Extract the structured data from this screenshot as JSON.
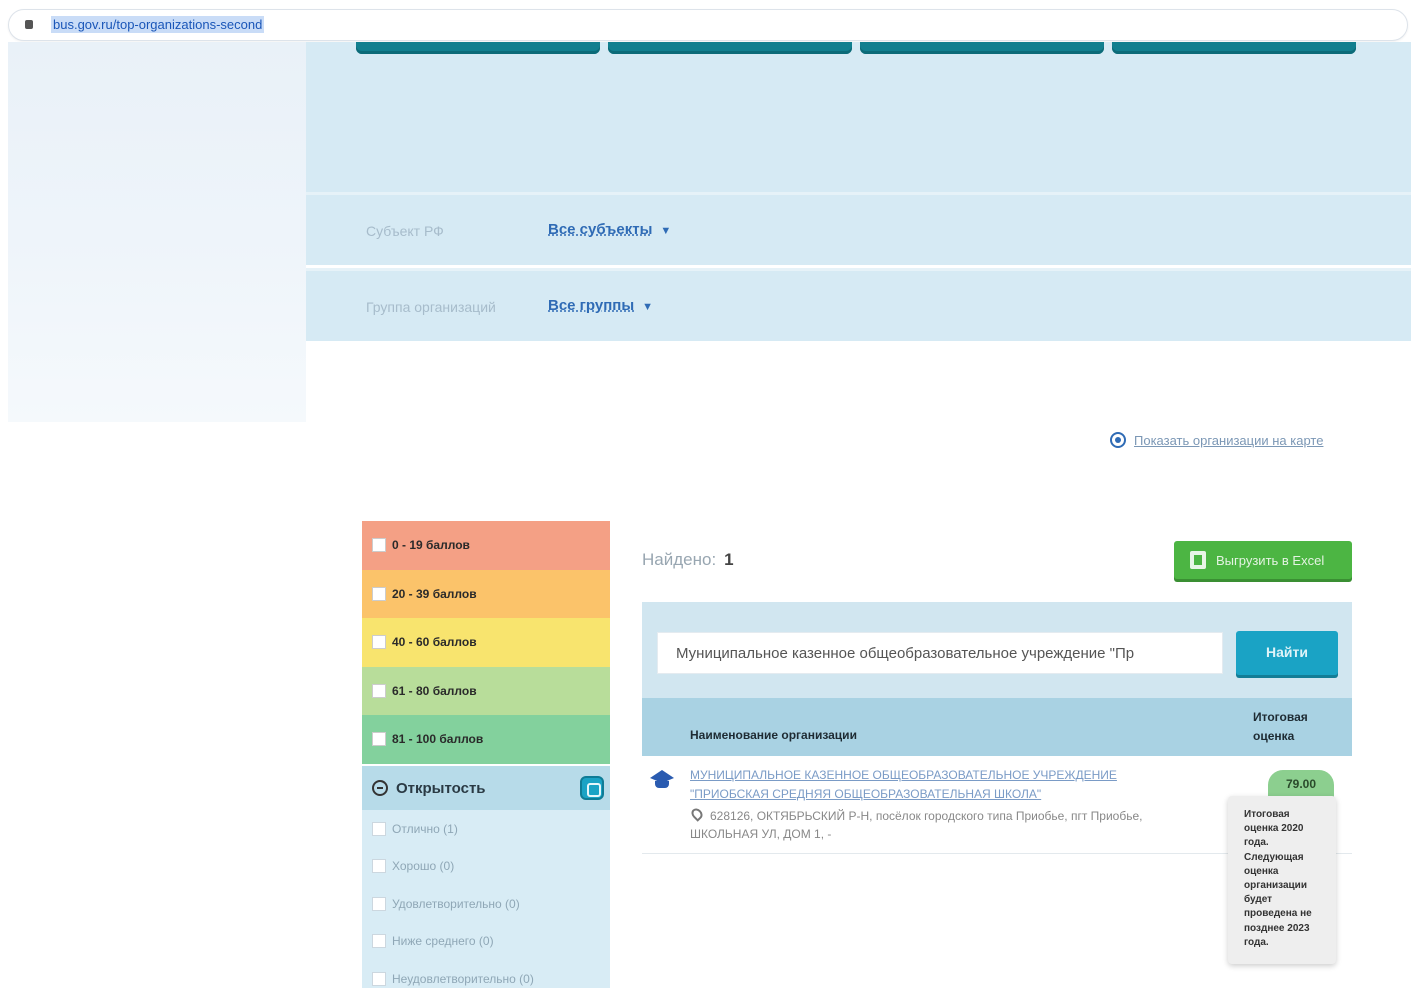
{
  "browser": {
    "url": "bus.gov.ru/top-organizations-second"
  },
  "filters": {
    "subject": {
      "label": "Субъект РФ",
      "value": "Все субъекты"
    },
    "group": {
      "label": "Группа организаций",
      "value": "Все группы"
    },
    "dropdown_arrow": "▼"
  },
  "map_link": {
    "label": "Показать организации на карте",
    "icon": "map-pin-icon"
  },
  "score_filters": [
    {
      "label": "0 - 19 баллов",
      "color": "#f4a085"
    },
    {
      "label": "20 - 39 баллов",
      "color": "#fbc36a"
    },
    {
      "label": "40 - 60 баллов",
      "color": "#f8e46e"
    },
    {
      "label": "61 - 80 баллов",
      "color": "#b8dd9a"
    },
    {
      "label": "81 - 100 баллов",
      "color": "#83d19d"
    }
  ],
  "openness": {
    "title": "Открытость",
    "items": [
      {
        "label": "Отлично (1)"
      },
      {
        "label": "Хорошо (0)"
      },
      {
        "label": "Удовлетворительно (0)"
      },
      {
        "label": "Ниже среднего (0)"
      },
      {
        "label": "Неудовлетворительно (0)"
      }
    ]
  },
  "results": {
    "found_label": "Найдено:",
    "found_count": "1",
    "export_label": "Выгрузить в Excel",
    "search_value": "Муниципальное казенное общеобразовательное учреждение \"Пр",
    "search_button": "Найти",
    "col_name": "Наименование организации",
    "col_score": "Итоговая оценка",
    "rows": [
      {
        "name": "МУНИЦИПАЛЬНОЕ КАЗЕННОЕ ОБЩЕОБРАЗОВАТЕЛЬНОЕ УЧРЕЖДЕНИЕ \"ПРИОБСКАЯ СРЕДНЯЯ ОБЩЕОБРАЗОВАТЕЛЬНАЯ ШКОЛА\"",
        "address_line1": "628126, ОКТЯБРЬСКИЙ Р-Н, посёлок городского типа Приобье, пгт Приобье,",
        "address_line2": "ШКОЛЬНАЯ УЛ, ДОМ 1, -",
        "score": "79.00",
        "tooltip": "Итоговая оценка 2020 года. Следующая оценка организации будет проведена не позднее 2023 года."
      }
    ]
  }
}
